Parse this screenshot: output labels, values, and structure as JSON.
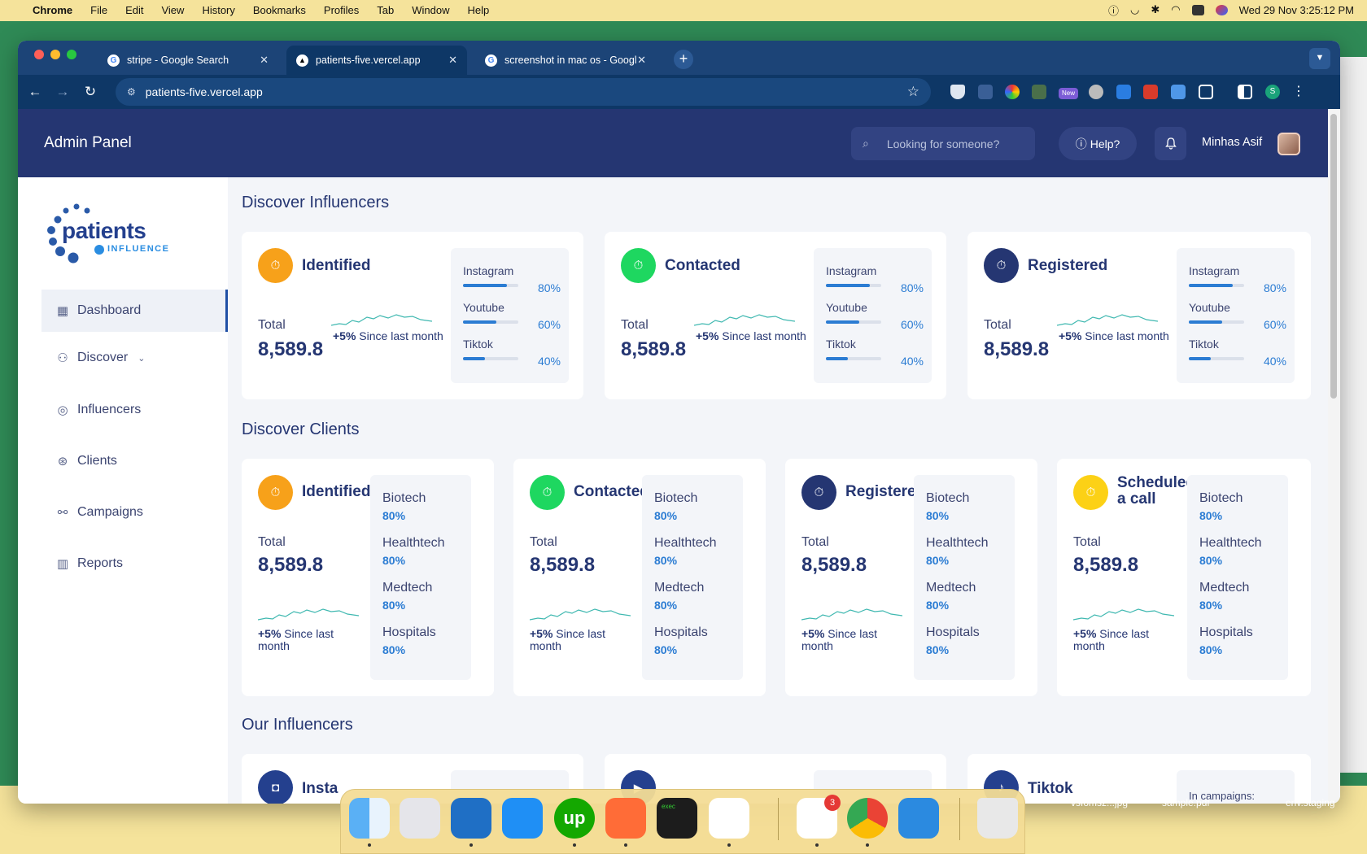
{
  "menubar": {
    "app": "Chrome",
    "items": [
      "File",
      "Edit",
      "View",
      "History",
      "Bookmarks",
      "Profiles",
      "Tab",
      "Window",
      "Help"
    ],
    "datetime": "Wed 29 Nov  3:25:12 PM"
  },
  "browser": {
    "tabs": [
      {
        "label": "stripe - Google Search"
      },
      {
        "label": "patients-five.vercel.app"
      },
      {
        "label": "screenshot in mac os - Googl"
      }
    ],
    "url": "patients-five.vercel.app",
    "profile_initial": "S",
    "ext_badge": "New"
  },
  "app": {
    "title": "Admin Panel",
    "search_placeholder": "Looking for someone?",
    "help_label": "Help?",
    "user_name": "Minhas Asif",
    "logo_main": "patients",
    "logo_sub": "INFLUENCE"
  },
  "sidebar": {
    "items": [
      {
        "label": "Dashboard"
      },
      {
        "label": "Discover"
      },
      {
        "label": "Influencers"
      },
      {
        "label": "Clients"
      },
      {
        "label": "Campaigns"
      },
      {
        "label": "Reports"
      }
    ]
  },
  "sections": {
    "influencers": "Discover Influencers",
    "clients": "Discover Clients",
    "ours": "Our Influencers"
  },
  "influencer_cards": [
    {
      "title": "Identified",
      "color": "#f7a11a",
      "total_label": "Total",
      "total": "8,589.8",
      "since_bold": "+5%",
      "since": " Since last month",
      "platforms": [
        {
          "name": "Instagram",
          "pct": "80%",
          "fill": 0.8
        },
        {
          "name": "Youtube",
          "pct": "60%",
          "fill": 0.6
        },
        {
          "name": "Tiktok",
          "pct": "40%",
          "fill": 0.4
        }
      ]
    },
    {
      "title": "Contacted",
      "color": "#1ed760",
      "total_label": "Total",
      "total": "8,589.8",
      "since_bold": "+5%",
      "since": " Since last month",
      "platforms": [
        {
          "name": "Instagram",
          "pct": "80%",
          "fill": 0.8
        },
        {
          "name": "Youtube",
          "pct": "60%",
          "fill": 0.6
        },
        {
          "name": "Tiktok",
          "pct": "40%",
          "fill": 0.4
        }
      ]
    },
    {
      "title": "Registered",
      "color": "#253672",
      "total_label": "Total",
      "total": "8,589.8",
      "since_bold": "+5%",
      "since": " Since last month",
      "platforms": [
        {
          "name": "Instagram",
          "pct": "80%",
          "fill": 0.8
        },
        {
          "name": "Youtube",
          "pct": "60%",
          "fill": 0.6
        },
        {
          "name": "Tiktok",
          "pct": "40%",
          "fill": 0.4
        }
      ]
    }
  ],
  "client_cards": [
    {
      "title": "Identified",
      "color": "#f7a11a",
      "total_label": "Total",
      "total": "8,589.8",
      "since_bold": "+5%",
      "since": " Since last month",
      "sectors": [
        {
          "name": "Biotech",
          "pct": "80%"
        },
        {
          "name": "Healthtech",
          "pct": "80%"
        },
        {
          "name": "Medtech",
          "pct": "80%"
        },
        {
          "name": "Hospitals",
          "pct": "80%"
        }
      ]
    },
    {
      "title": "Contacted",
      "color": "#1ed760",
      "total_label": "Total",
      "total": "8,589.8",
      "since_bold": "+5%",
      "since": " Since last month",
      "sectors": [
        {
          "name": "Biotech",
          "pct": "80%"
        },
        {
          "name": "Healthtech",
          "pct": "80%"
        },
        {
          "name": "Medtech",
          "pct": "80%"
        },
        {
          "name": "Hospitals",
          "pct": "80%"
        }
      ]
    },
    {
      "title": "Registered",
      "color": "#253672",
      "total_label": "Total",
      "total": "8,589.8",
      "since_bold": "+5%",
      "since": " Since last month",
      "sectors": [
        {
          "name": "Biotech",
          "pct": "80%"
        },
        {
          "name": "Healthtech",
          "pct": "80%"
        },
        {
          "name": "Medtech",
          "pct": "80%"
        },
        {
          "name": "Hospitals",
          "pct": "80%"
        }
      ]
    },
    {
      "title": "Scheduled a call",
      "color": "#fcd116",
      "total_label": "Total",
      "total": "8,589.8",
      "since_bold": "+5%",
      "since": " Since last month",
      "sectors": [
        {
          "name": "Biotech",
          "pct": "80%"
        },
        {
          "name": "Healthtech",
          "pct": "80%"
        },
        {
          "name": "Medtech",
          "pct": "80%"
        },
        {
          "name": "Hospitals",
          "pct": "80%"
        }
      ]
    }
  ],
  "our_influencers": {
    "cards": [
      {
        "title": "Insta"
      },
      {
        "title": ""
      },
      {
        "title": "Tiktok",
        "side": "In campaigns:"
      }
    ]
  },
  "dock": {
    "slack_badge": "3",
    "exec_label": "exec"
  },
  "desktop_files": [
    "vsfomsz...jpg",
    "sample.pdf",
    "env.staging"
  ]
}
